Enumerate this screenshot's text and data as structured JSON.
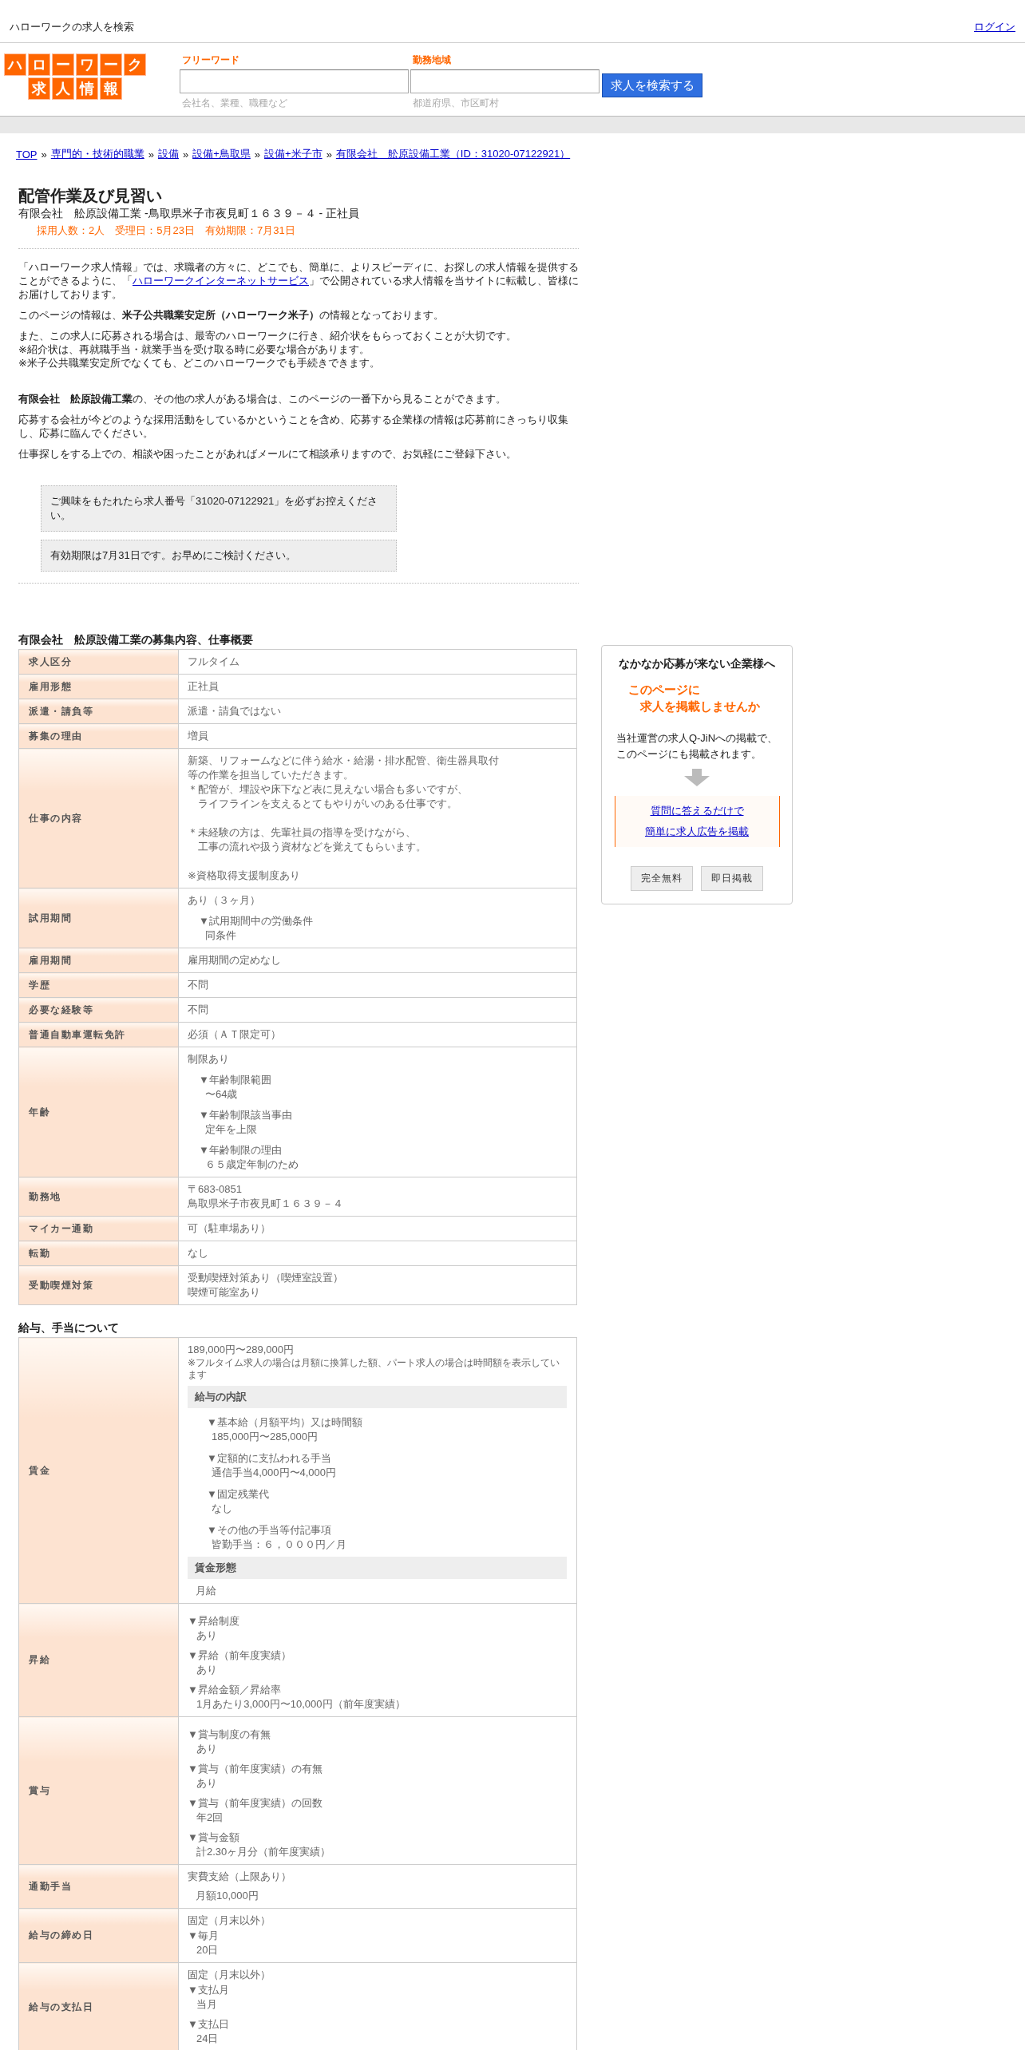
{
  "top_bar": {
    "title": "ハローワークの求人を検索",
    "login": "ログイン"
  },
  "header": {
    "logo_rows": [
      "ハローワーク",
      "求人情報"
    ],
    "fields": [
      {
        "label": "フリーワード",
        "hint": "会社名、業種、職種など",
        "wide": true
      },
      {
        "label": "勤務地域",
        "hint": "都道府県、市区町村",
        "wide": false
      }
    ],
    "search_button": "求人を検索する"
  },
  "breadcrumb": [
    {
      "kind": "link",
      "text": "TOP"
    },
    {
      "kind": "sep",
      "text": "»"
    },
    {
      "kind": "link",
      "text": "専門的・技術的職業"
    },
    {
      "kind": "sep",
      "text": "»"
    },
    {
      "kind": "link",
      "text": "設備"
    },
    {
      "kind": "sep",
      "text": "»"
    },
    {
      "kind": "link",
      "text": "設備+鳥取県"
    },
    {
      "kind": "sep",
      "text": "»"
    },
    {
      "kind": "link",
      "text": "設備+米子市"
    },
    {
      "kind": "sep",
      "text": "»"
    },
    {
      "kind": "link",
      "text": "有限会社　舩原設備工業（ID：31020-07122921）"
    }
  ],
  "job": {
    "title": "配管作業及び見習い",
    "subtitle": "有限会社　舩原設備工業 -鳥取県米子市夜見町１６３９－４ - 正社員",
    "meta": "採用人数：2人　受理日：5月23日　有効期限：7月31日"
  },
  "intro": [
    {
      "kind": "linked",
      "before": "「ハローワーク求人情報」では、求職者の方々に、どこでも、簡単に、よりスピーディに、お探しの求人情報を提供することができるように、「",
      "link": "ハローワークインターネットサービス",
      "after": "」で公開されている求人情報を当サイトに転載し、皆様にお届けしております。"
    },
    {
      "kind": "plain",
      "text": "このページの情報は、**米子公共職業安定所（ハローワーク米子）**の情報となっております。"
    },
    {
      "kind": "lines",
      "lines": [
        "また、この求人に応募される場合は、最寄のハローワークに行き、紹介状をもらっておくことが大切です。",
        "※紹介状は、再就職手当・就業手当を受け取る時に必要な場合があります。",
        "※米子公共職業安定所でなくても、どこのハローワークでも手続きできます。"
      ]
    },
    {
      "kind": "spaced",
      "text": "**有限会社　舩原設備工業**の、その他の求人がある場合は、このページの一番下から見ることができます。"
    },
    {
      "kind": "plain",
      "text": "応募する会社が今どのような採用活動をしているかということを含め、応募する企業様の情報は応募前にきっちり収集し、応募に臨んでください。"
    },
    {
      "kind": "plain",
      "text": "仕事探しをする上での、相談や困ったことがあればメールにて相談承りますので、お気軽にご登録下さい。"
    }
  ],
  "notices": [
    "ご興味をもたれたら求人番号「31020-07122921」を必ずお控えください。",
    "有効期限は7月31日です。お早めにご検討ください。"
  ],
  "sections": [
    {
      "title": "有限会社　舩原設備工業の募集内容、仕事概要",
      "rows": [
        {
          "label": "求人区分",
          "content": [
            {
              "kind": "text",
              "text": "フルタイム"
            }
          ]
        },
        {
          "label": "雇用形態",
          "content": [
            {
              "kind": "text",
              "text": "正社員"
            }
          ]
        },
        {
          "label": "派遣・請負等",
          "content": [
            {
              "kind": "text",
              "text": "派遣・請負ではない"
            }
          ]
        },
        {
          "label": "募集の理由",
          "content": [
            {
              "kind": "text",
              "text": "増員"
            }
          ]
        },
        {
          "label": "仕事の内容",
          "content": [
            {
              "kind": "text",
              "lines": [
                "新築、リフォームなどに伴う給水・給湯・排水配管、衛生器具取付",
                "等の作業を担当していただきます。",
                "＊配管が、埋設や床下など表に見えない場合も多いですが、",
                "　ライフラインを支えるとてもやりがいのある仕事です。"
              ]
            },
            {
              "kind": "para",
              "lines": [
                "＊未経験の方は、先輩社員の指導を受けながら、",
                "　工事の流れや扱う資材などを覚えてもらいます。"
              ]
            },
            {
              "kind": "para",
              "lines": [
                "※資格取得支援制度あり"
              ]
            }
          ]
        },
        {
          "label": "試用期間",
          "content": [
            {
              "kind": "text",
              "text": "あり（３ヶ月）"
            },
            {
              "kind": "nested_item",
              "label": "▼試用期間中の労働条件",
              "value": "同条件"
            }
          ]
        },
        {
          "label": "雇用期間",
          "content": [
            {
              "kind": "text",
              "text": "雇用期間の定めなし"
            }
          ]
        },
        {
          "label": "学歴",
          "content": [
            {
              "kind": "text",
              "text": "不問"
            }
          ]
        },
        {
          "label": "必要な経験等",
          "content": [
            {
              "kind": "text",
              "text": "不問"
            }
          ]
        },
        {
          "label": "普通自動車運転免許",
          "content": [
            {
              "kind": "text",
              "text": "必須（ＡＴ限定可）"
            }
          ]
        },
        {
          "label": "年齢",
          "content": [
            {
              "kind": "text",
              "text": "制限あり"
            },
            {
              "kind": "nested_item",
              "label": "▼年齢制限範囲",
              "value": "〜64歳"
            },
            {
              "kind": "nested_item",
              "label": "▼年齢制限該当事由",
              "value": "定年を上限"
            },
            {
              "kind": "nested_item",
              "label": "▼年齢制限の理由",
              "value": "６５歳定年制のため"
            }
          ]
        },
        {
          "label": "勤務地",
          "content": [
            {
              "kind": "text",
              "lines": [
                "〒683-0851",
                "鳥取県米子市夜見町１６３９－４"
              ]
            }
          ]
        },
        {
          "label": "マイカー通勤",
          "content": [
            {
              "kind": "text",
              "text": "可（駐車場あり）"
            }
          ]
        },
        {
          "label": "転勤",
          "content": [
            {
              "kind": "text",
              "text": "なし"
            }
          ]
        },
        {
          "label": "受動喫煙対策",
          "content": [
            {
              "kind": "text",
              "lines": [
                "受動喫煙対策あり（喫煙室設置）",
                "喫煙可能室あり"
              ]
            }
          ]
        }
      ]
    },
    {
      "title": "給与、手当について",
      "rows": [
        {
          "label": "賃金",
          "content": [
            {
              "kind": "text",
              "text": "189,000円〜289,000円"
            },
            {
              "kind": "note",
              "text": "※フルタイム求人の場合は月額に換算した額、パート求人の場合は時間額を表示しています"
            },
            {
              "kind": "heading",
              "text": "給与の内訳"
            },
            {
              "kind": "deep_item",
              "label": "▼基本給（月額平均）又は時間額",
              "value": "185,000円〜285,000円"
            },
            {
              "kind": "deep_item",
              "label": "▼定額的に支払われる手当",
              "value": "通信手当4,000円〜4,000円"
            },
            {
              "kind": "deep_item",
              "label": "▼固定残業代",
              "value": "なし"
            },
            {
              "kind": "deep_item",
              "label": "▼その他の手当等付記事項",
              "value": "皆勤手当：６，０００円／月"
            },
            {
              "kind": "heading",
              "text": "賃金形態"
            },
            {
              "kind": "indented",
              "text": "月給"
            }
          ]
        },
        {
          "label": "昇給",
          "content": [
            {
              "kind": "item",
              "label": "▼昇給制度",
              "value": "あり"
            },
            {
              "kind": "item",
              "label": "▼昇給（前年度実績）",
              "value": "あり"
            },
            {
              "kind": "item",
              "label": "▼昇給金額／昇給率",
              "value": "1月あたり3,000円〜10,000円（前年度実績）"
            }
          ]
        },
        {
          "label": "賞与",
          "content": [
            {
              "kind": "item",
              "label": "▼賞与制度の有無",
              "value": "あり"
            },
            {
              "kind": "item",
              "label": "▼賞与（前年度実績）の有無",
              "value": "あり"
            },
            {
              "kind": "item",
              "label": "▼賞与（前年度実績）の回数",
              "value": "年2回"
            },
            {
              "kind": "item",
              "label": "▼賞与金額",
              "value": "計2.30ヶ月分（前年度実績）"
            }
          ]
        },
        {
          "label": "通勤手当",
          "content": [
            {
              "kind": "text",
              "text": "実費支給（上限あり）"
            },
            {
              "kind": "indented",
              "text": "月額10,000円"
            }
          ]
        },
        {
          "label": "給与の締め日",
          "content": [
            {
              "kind": "text",
              "text": "固定（月末以外）"
            },
            {
              "kind": "tight_item",
              "label": "▼毎月",
              "value": "20日"
            }
          ]
        },
        {
          "label": "給与の支払日",
          "content": [
            {
              "kind": "text",
              "text": "固定（月末以外）"
            },
            {
              "kind": "tight_item",
              "label": "▼支払月",
              "value": "当月"
            },
            {
              "kind": "item",
              "label": "▼支払日",
              "value": "24日"
            }
          ]
        }
      ]
    }
  ],
  "promo": {
    "title": "なかなか応募が来ない企業様へ",
    "catch": [
      "このページに",
      "求人を掲載しませんか"
    ],
    "body": [
      "当社運営の求人Q-JiNへの掲載で、",
      "このページにも掲載されます。"
    ],
    "links": [
      "質問に答えるだけで",
      "簡単に求人広告を掲載"
    ],
    "buttons": [
      "完全無料",
      "即日掲載"
    ]
  }
}
